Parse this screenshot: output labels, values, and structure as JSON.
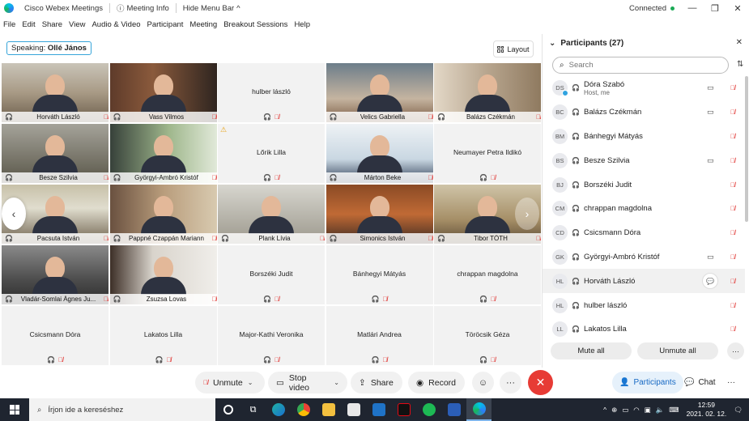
{
  "window": {
    "app_title": "Cisco Webex Meetings",
    "meeting_info": "Meeting Info",
    "hide_menu_bar": "Hide Menu Bar",
    "status": "Connected"
  },
  "menu": [
    "File",
    "Edit",
    "Share",
    "View",
    "Audio & Video",
    "Participant",
    "Meeting",
    "Breakout Sessions",
    "Help"
  ],
  "speaking": {
    "label": "Speaking:",
    "name": "Ollé János"
  },
  "layout_label": "Layout",
  "tiles": [
    {
      "name": "Horváth László",
      "video": true
    },
    {
      "name": "Vass Vilmos",
      "video": true
    },
    {
      "name": "hulber lászló",
      "video": false
    },
    {
      "name": "Velics Gabriella",
      "video": true
    },
    {
      "name": "Balázs Czékmán",
      "video": true
    },
    {
      "name": "Besze Szilvia",
      "video": true
    },
    {
      "name": "Györgyi-Ambró Kristóf",
      "video": true
    },
    {
      "name": "Lőrik Lilla",
      "video": false
    },
    {
      "name": "Márton Beke",
      "video": true
    },
    {
      "name": "Neumayer Petra Ildikó",
      "video": false
    },
    {
      "name": "Pacsuta István",
      "video": true
    },
    {
      "name": "Pappné Czappán Mariann",
      "video": true
    },
    {
      "name": "Plank Lívia",
      "video": true
    },
    {
      "name": "Simonics István",
      "video": true
    },
    {
      "name": "Tibor TÓTH",
      "video": true
    },
    {
      "name": "Vladár-Somlai Ágnes Ju...",
      "video": true
    },
    {
      "name": "Zsuzsa Lovas",
      "video": true
    },
    {
      "name": "Borszéki Judit",
      "video": false
    },
    {
      "name": "Bánhegyi Mátyás",
      "video": false
    },
    {
      "name": "chrappan magdolna",
      "video": false
    },
    {
      "name": "Csicsmann Dóra",
      "video": false
    },
    {
      "name": "Lakatos Lilla",
      "video": false
    },
    {
      "name": "Major-Kathi Veronika",
      "video": false
    },
    {
      "name": "Matlári Andrea",
      "video": false
    },
    {
      "name": "Töröcsik Géza",
      "video": false
    }
  ],
  "controls": {
    "unmute": "Unmute",
    "stop_video": "Stop video",
    "share": "Share",
    "record": "Record",
    "participants": "Participants",
    "chat": "Chat"
  },
  "panel": {
    "title": "Participants (27)",
    "search_placeholder": "Search",
    "mute_all": "Mute all",
    "unmute_all": "Unmute all",
    "participants": [
      {
        "initials": "DS",
        "name": "Dóra Szabó",
        "sub": "Host, me",
        "cam": true
      },
      {
        "initials": "BC",
        "name": "Balázs Czékmán",
        "sub": "",
        "cam": true
      },
      {
        "initials": "BM",
        "name": "Bánhegyi Mátyás",
        "sub": "",
        "cam": false
      },
      {
        "initials": "BS",
        "name": "Besze Szilvia",
        "sub": "",
        "cam": true
      },
      {
        "initials": "BJ",
        "name": "Borszéki Judit",
        "sub": "",
        "cam": false
      },
      {
        "initials": "CM",
        "name": "chrappan magdolna",
        "sub": "",
        "cam": false
      },
      {
        "initials": "CD",
        "name": "Csicsmann Dóra",
        "sub": "",
        "cam": false
      },
      {
        "initials": "GK",
        "name": "Györgyi-Ambró Kristóf",
        "sub": "",
        "cam": true
      },
      {
        "initials": "HL",
        "name": "Horváth László",
        "sub": "",
        "cam": false
      },
      {
        "initials": "HL",
        "name": "hulber lászló",
        "sub": "",
        "cam": false
      },
      {
        "initials": "LL",
        "name": "Lakatos Lilla",
        "sub": "",
        "cam": false
      }
    ]
  },
  "taskbar": {
    "search_placeholder": "Írjon ide a kereséshez",
    "time": "12:59",
    "date": "2021. 02. 12."
  }
}
